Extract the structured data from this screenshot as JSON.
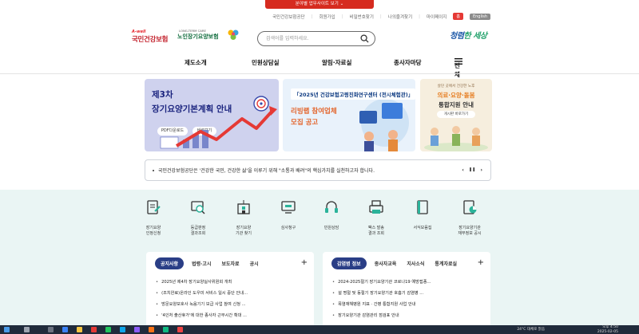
{
  "banner": {
    "label": "분야별 업무사이트 보기 ⌄"
  },
  "utility": {
    "links": [
      "국민건강보험공단",
      "회원가입",
      "비밀번호찾기",
      "나의즐겨찾기",
      "마이페이지"
    ],
    "sitemap": "홈",
    "english": "English"
  },
  "logos": {
    "nhis_small": "A-well",
    "nhis": "국민건강보험",
    "ltc_small": "LONG-TERM CARE",
    "ltc": "노인장기요양보험"
  },
  "search": {
    "placeholder": "검색어를 입력하세요."
  },
  "slogan": {
    "part1": "청렴",
    "part2": "한 세상"
  },
  "gnb": {
    "items": [
      "제도소개",
      "민원상담실",
      "알림·자료실",
      "종사자마당"
    ],
    "all_menu": "전체메뉴"
  },
  "cards": {
    "plan": {
      "line1": "제3차",
      "line2": "장기요양기본계획 안내",
      "pdf_btn": "PDF다운로드",
      "view_btn": "바로보기"
    },
    "recruit": {
      "band": "「2025년 건강보험고령친화연구센터 (전시체험관)」",
      "line1": "리빙랩 참여업체",
      "line2": "모집 공고"
    },
    "integrated": {
      "sub": "살던 곳에서 건강한 노후",
      "title_a": "의료·요양·돌봄",
      "title_b": "통합지원 안내",
      "btn": "게시판 바로가기"
    }
  },
  "notice": {
    "text": "국민건강보험공단은 '건강한 국민, 건강한 삶'을 이루기 위해 \"소통과 배려\"의 핵심가치를 실천하고자 합니다.",
    "prev": "‹",
    "pause": "❚❚",
    "next": "›"
  },
  "services": [
    {
      "line1": "장기요양",
      "line2": "인정신청",
      "icon": "document-edit-icon"
    },
    {
      "line1": "등급판정",
      "line2": "결과조회",
      "icon": "search-document-icon"
    },
    {
      "line1": "장기요양",
      "line2": "기관 찾기",
      "icon": "building-icon"
    },
    {
      "line1": "심사청구",
      "line2": "",
      "icon": "monitor-icon"
    },
    {
      "line1": "민원상담",
      "line2": "",
      "icon": "headset-icon"
    },
    {
      "line1": "팩스 발송",
      "line2": "결과 조회",
      "icon": "fax-icon"
    },
    {
      "line1": "서식모음집",
      "line2": "",
      "icon": "book-icon"
    },
    {
      "line1": "장기요양기관",
      "line2": "재무정보 공시",
      "icon": "chart-document-icon"
    }
  ],
  "panel_left": {
    "active_tab": "공지사항",
    "tabs": [
      "법령·고시",
      "보도자료",
      "공시"
    ],
    "items": [
      "2025년 제4차 장기요양실사위원회 개최",
      "(조치완료)온라인 도우미 서비스 일시 중단 안내...",
      "방문요양보호사 녹음기기 보급 사업 참여 신청 ...",
      "'4인처 출산휴가'에 대한 종사자 근무시간 확대 ..."
    ]
  },
  "panel_right": {
    "active_tab": "감염병 정보",
    "tabs": [
      "종사자교육",
      "지사소식",
      "통계자료실"
    ],
    "items": [
      "2024-2025절기 장기요양기관 코로나19 예방접종...",
      "설 명절 및 동절기 장기요양기관 호흡기 감염병 ...",
      "폭염재해병원 지표 · 간병 통합지원 사업 안내",
      "장기요양기관 감염관리 점검표 안내"
    ]
  },
  "taskbar": {
    "weather": "24°C 대체로 맑음",
    "time": "오후 4:50",
    "date": "2025-02-05"
  }
}
